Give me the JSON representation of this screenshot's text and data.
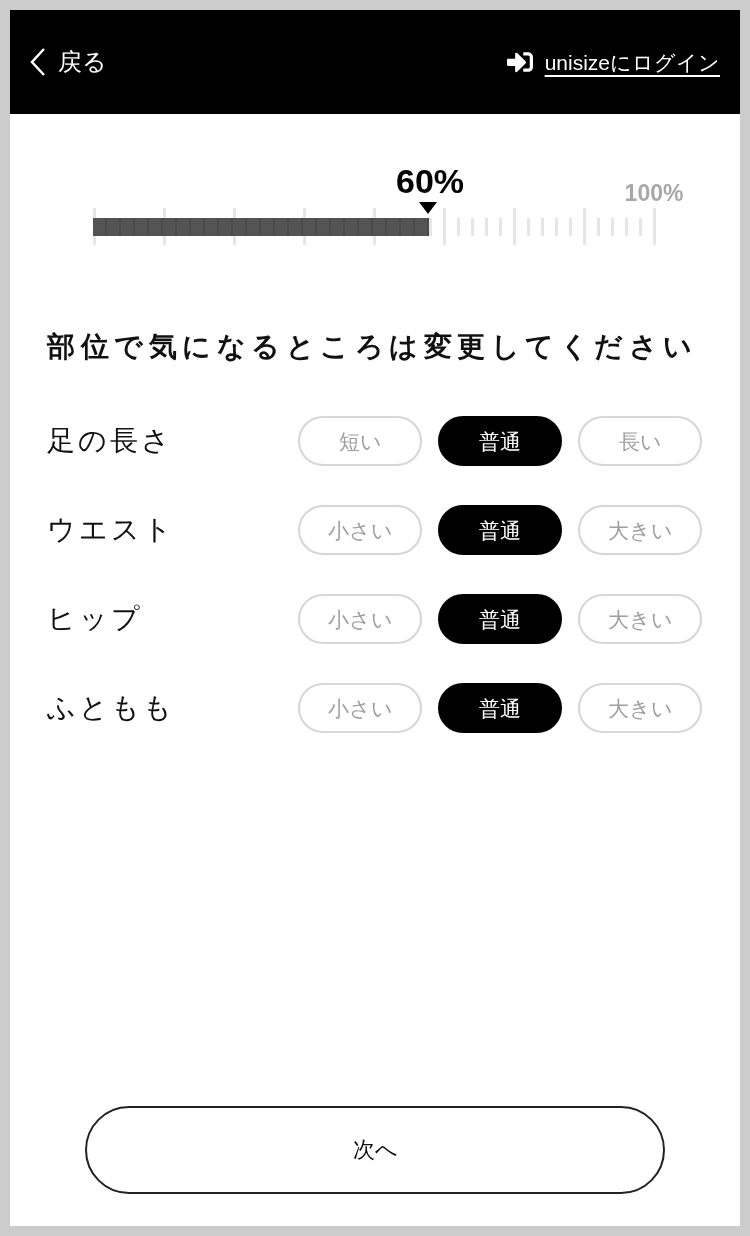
{
  "header": {
    "back": {
      "label": "戻る"
    },
    "login": {
      "label": "unisizeにログイン"
    }
  },
  "progress": {
    "level": 0.6,
    "reading": "60%",
    "max_label": "100%"
  },
  "instruction": "部位で気になるところは変更してください",
  "body_parts": [
    {
      "label": "足の長さ",
      "options": [
        {
          "label": "短い",
          "selected": false
        },
        {
          "label": "普通",
          "selected": true
        },
        {
          "label": "長い",
          "selected": false
        }
      ]
    },
    {
      "label": "ウエスト",
      "options": [
        {
          "label": "小さい",
          "selected": false
        },
        {
          "label": "普通",
          "selected": true
        },
        {
          "label": "大きい",
          "selected": false
        }
      ]
    },
    {
      "label": "ヒップ",
      "options": [
        {
          "label": "小さい",
          "selected": false
        },
        {
          "label": "普通",
          "selected": true
        },
        {
          "label": "大きい",
          "selected": false
        }
      ]
    },
    {
      "label": "ふともも",
      "options": [
        {
          "label": "小さい",
          "selected": false
        },
        {
          "label": "普通",
          "selected": true
        },
        {
          "label": "大きい",
          "selected": false
        }
      ]
    }
  ],
  "next_button": {
    "label": "次へ"
  }
}
